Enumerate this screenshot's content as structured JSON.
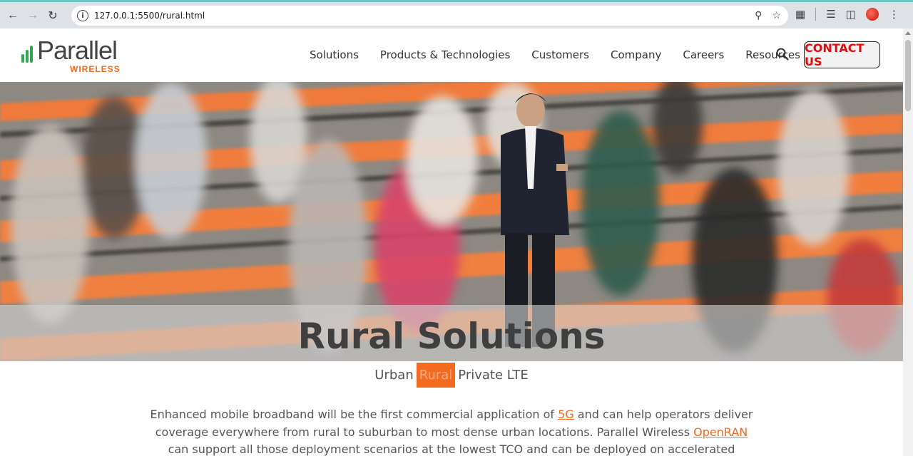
{
  "browser": {
    "url": "127.0.0.1:5500/rural.html",
    "icons": [
      "back-icon",
      "forward-icon",
      "reload-icon",
      "site-info-icon",
      "zoom-icon",
      "bookmark-star-icon",
      "extensions-icon",
      "media-icon",
      "side-panel-icon",
      "profile-icon",
      "menu-icon"
    ]
  },
  "header": {
    "logo_word": "Parallel",
    "logo_sub": "WIRELESS",
    "nav": [
      "Solutions",
      "Products & Technologies",
      "Customers",
      "Company",
      "Careers",
      "Resources"
    ],
    "contact_label": "CONTACT US"
  },
  "hero": {
    "title": "Rural Solutions"
  },
  "tabs": [
    "Urban",
    "Rural",
    "Private LTE"
  ],
  "active_tab": "Rural",
  "intro": {
    "part1": "Enhanced mobile broadband will be the first commercial application of ",
    "link1": "5G",
    "part2": " and can help operators deliver coverage everywhere from rural to suburban to most dense urban locations. Parallel Wireless ",
    "link2": "OpenRAN",
    "part3": " can support all those deployment scenarios at the lowest TCO and can be deployed on accelerated timeline."
  },
  "colors": {
    "brand_orange": "#f26b21",
    "brand_green": "#2fa84f",
    "contact_red": "#e40a0a"
  }
}
